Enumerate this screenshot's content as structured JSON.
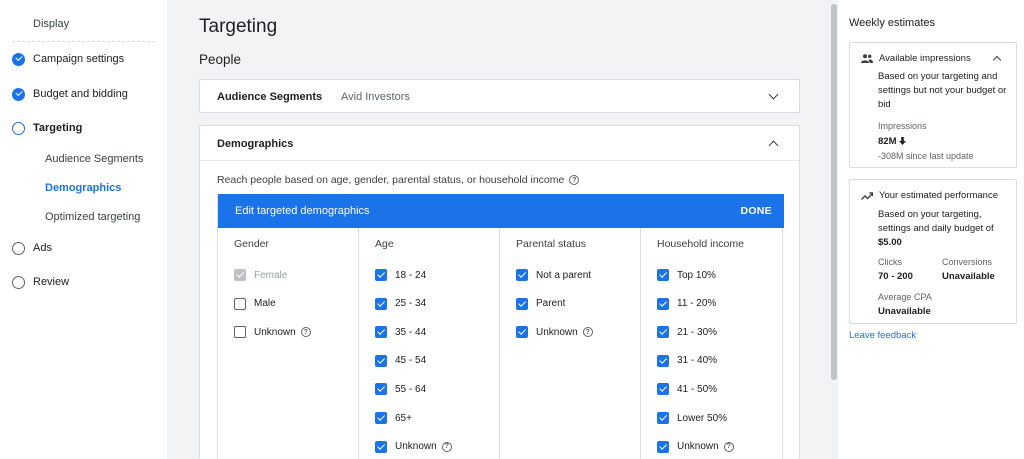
{
  "sidebar": {
    "display_label": "Display",
    "steps": [
      {
        "label": "Campaign settings",
        "state": "done"
      },
      {
        "label": "Budget and bidding",
        "state": "done"
      },
      {
        "label": "Targeting",
        "state": "current"
      },
      {
        "label": "Ads",
        "state": "todo"
      },
      {
        "label": "Review",
        "state": "todo"
      }
    ],
    "sub_items": [
      {
        "label": "Audience Segments"
      },
      {
        "label": "Demographics",
        "active": true
      },
      {
        "label": "Optimized targeting"
      }
    ]
  },
  "main": {
    "page_title": "Targeting",
    "section_title": "People",
    "audience_card": {
      "label": "Audience Segments",
      "value": "Avid Investors"
    },
    "demographics_card": {
      "label": "Demographics",
      "description": "Reach people based on age, gender, parental status, or household income",
      "editor_title": "Edit targeted demographics",
      "done_label": "DONE",
      "columns": [
        {
          "header": "Gender",
          "options": [
            {
              "label": "Female",
              "state": "disabled"
            },
            {
              "label": "Male",
              "state": "off"
            },
            {
              "label": "Unknown",
              "state": "off",
              "help": true
            }
          ]
        },
        {
          "header": "Age",
          "options": [
            {
              "label": "18 - 24",
              "state": "on"
            },
            {
              "label": "25 - 34",
              "state": "on"
            },
            {
              "label": "35 - 44",
              "state": "on"
            },
            {
              "label": "45 - 54",
              "state": "on"
            },
            {
              "label": "55 - 64",
              "state": "on"
            },
            {
              "label": "65+",
              "state": "on"
            },
            {
              "label": "Unknown",
              "state": "on",
              "help": true
            }
          ]
        },
        {
          "header": "Parental status",
          "options": [
            {
              "label": "Not a parent",
              "state": "on"
            },
            {
              "label": "Parent",
              "state": "on"
            },
            {
              "label": "Unknown",
              "state": "on",
              "help": true
            }
          ]
        },
        {
          "header": "Household income",
          "options": [
            {
              "label": "Top 10%",
              "state": "on"
            },
            {
              "label": "11 - 20%",
              "state": "on"
            },
            {
              "label": "21 - 30%",
              "state": "on"
            },
            {
              "label": "31 - 40%",
              "state": "on"
            },
            {
              "label": "41 - 50%",
              "state": "on"
            },
            {
              "label": "Lower 50%",
              "state": "on"
            },
            {
              "label": "Unknown",
              "state": "on",
              "help": true
            }
          ]
        }
      ]
    }
  },
  "right_panel": {
    "title": "Weekly estimates",
    "impressions_card": {
      "title": "Available impressions",
      "body": "Based on your targeting and settings but not your budget or bid",
      "metric_label": "Impressions",
      "metric_value": "82M",
      "change_text": "-308M since last update"
    },
    "performance_card": {
      "title": "Your estimated performance",
      "body_prefix": "Based on your targeting, settings and daily budget of ",
      "budget": "$5.00",
      "clicks_label": "Clicks",
      "clicks_value": "70 - 200",
      "conversions_label": "Conversions",
      "conversions_value": "Unavailable",
      "cpa_label": "Average CPA",
      "cpa_value": "Unavailable"
    },
    "feedback_link": "Leave feedback"
  },
  "help_glyph": "?",
  "colors": {
    "accent": "#1a73e8",
    "background": "#f1f3f4"
  }
}
